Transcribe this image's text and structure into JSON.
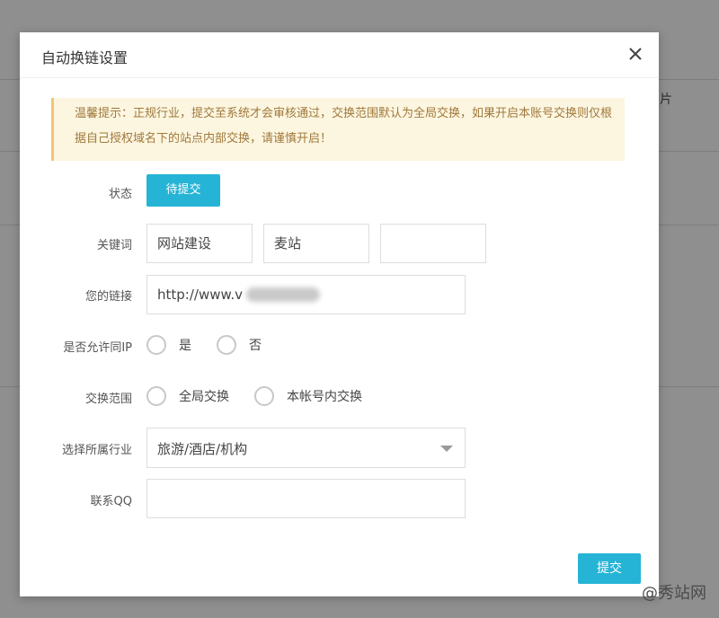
{
  "background": {
    "partial_text": "片"
  },
  "modal": {
    "title": "自动换链设置",
    "notice": "温馨提示：正规行业，提交至系统才会审核通过，交换范围默认为全局交换，如果开启本账号交换则仅根据自己授权域名下的站点内部交换，请谨慎开启！",
    "status": {
      "label": "状态",
      "value": "待提交"
    },
    "keywords": {
      "label": "关键词",
      "values": [
        "网站建设",
        "麦站",
        ""
      ]
    },
    "link": {
      "label": "您的链接",
      "value": "http://www.v"
    },
    "same_ip": {
      "label": "是否允许同IP",
      "options": [
        "是",
        "否"
      ]
    },
    "scope": {
      "label": "交换范围",
      "options": [
        "全局交换",
        "本帐号内交换"
      ]
    },
    "industry": {
      "label": "选择所属行业",
      "value": "旅游/酒店/机构"
    },
    "qq": {
      "label": "联系QQ",
      "value": ""
    },
    "submit_label": "提交"
  },
  "watermark": {
    "text": "@秀站网"
  },
  "colors": {
    "accent": "#26b4d6",
    "notice_bg": "#fcf6e1",
    "notice_text": "#a0783a"
  }
}
